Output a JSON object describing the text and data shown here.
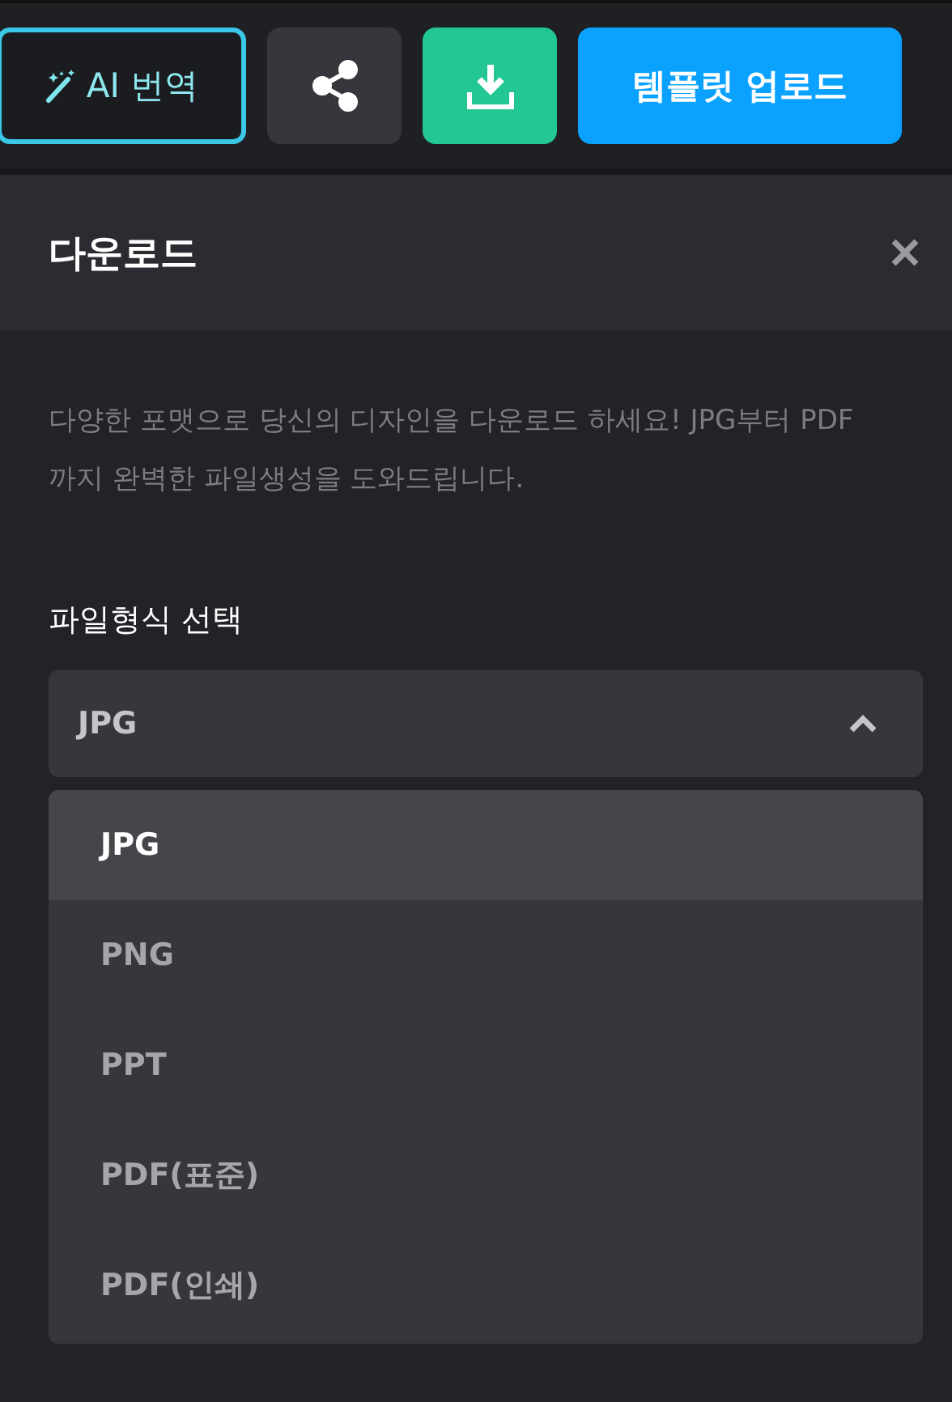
{
  "toolbar": {
    "buttons": [
      {
        "kind": "ai",
        "label": "AI 번역"
      },
      {
        "kind": "share"
      },
      {
        "kind": "download"
      },
      {
        "kind": "upload",
        "label": "템플릿 업로드"
      }
    ]
  },
  "panel": {
    "title": "다운로드",
    "description": "다양한 포맷으로 당신의 디자인을 다운로드 하세요! JPG부터 PDF까지 완벽한 파일생성을 도와드립니다.",
    "field_label": "파일형식 선택",
    "select": {
      "value": "JPG",
      "expanded": true,
      "options": [
        {
          "label": "JPG",
          "selected": true
        },
        {
          "label": "PNG",
          "selected": false
        },
        {
          "label": "PPT",
          "selected": false
        },
        {
          "label": "PDF(표준)",
          "selected": false
        },
        {
          "label": "PDF(인쇄)",
          "selected": false
        }
      ]
    }
  }
}
